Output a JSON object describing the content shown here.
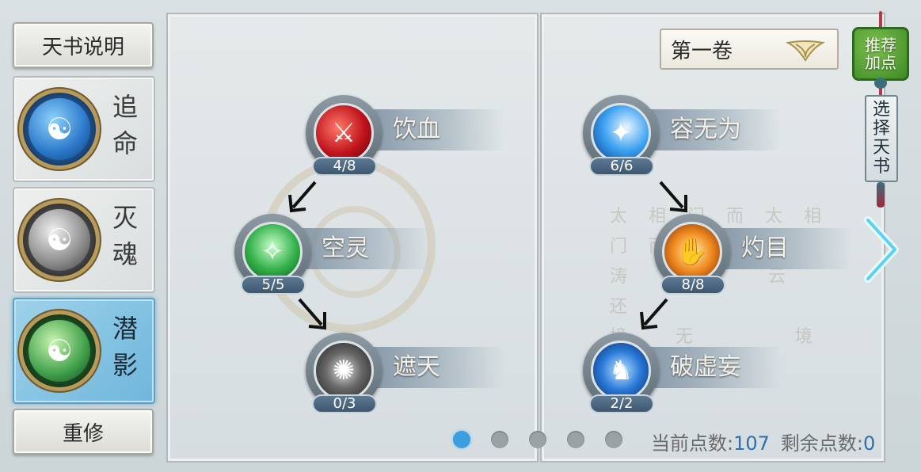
{
  "left_menu": {
    "help_label": "天书说明",
    "reset_label": "重修",
    "books": [
      {
        "name": "追命",
        "icon": "blue-dragon-mask-icon",
        "active": false
      },
      {
        "name": "灭魂",
        "icon": "silver-lion-mask-icon",
        "active": false
      },
      {
        "name": "潜影",
        "icon": "green-beast-mask-icon",
        "active": true
      }
    ]
  },
  "volume_select": {
    "label": "第一卷"
  },
  "side_tags": {
    "recommend_label": "推荐加点",
    "choose_label": "选择天书"
  },
  "skills_left": [
    {
      "name": "饮血",
      "level": "4/8",
      "icon": "blood-blade-icon"
    },
    {
      "name": "空灵",
      "level": "5/5",
      "icon": "green-spirit-icon"
    },
    {
      "name": "遮天",
      "level": "0/3",
      "icon": "dark-whirl-icon"
    }
  ],
  "skills_right": [
    {
      "name": "容无为",
      "level": "6/6",
      "icon": "blue-wave-icon"
    },
    {
      "name": "灼目",
      "level": "8/8",
      "icon": "fire-hand-icon"
    },
    {
      "name": "破虚妄",
      "level": "2/2",
      "icon": "blue-figure-icon"
    }
  ],
  "pagination": {
    "total": 5,
    "current": 1
  },
  "points": {
    "current_label": "当前点数:",
    "current_value": "107",
    "remaining_label": "剩余点数:",
    "remaining_value": "0"
  },
  "colors": {
    "accent_blue": "#3a9ee0",
    "active_tab": "#6fb6dc",
    "recommend_green": "#3f8a27"
  }
}
